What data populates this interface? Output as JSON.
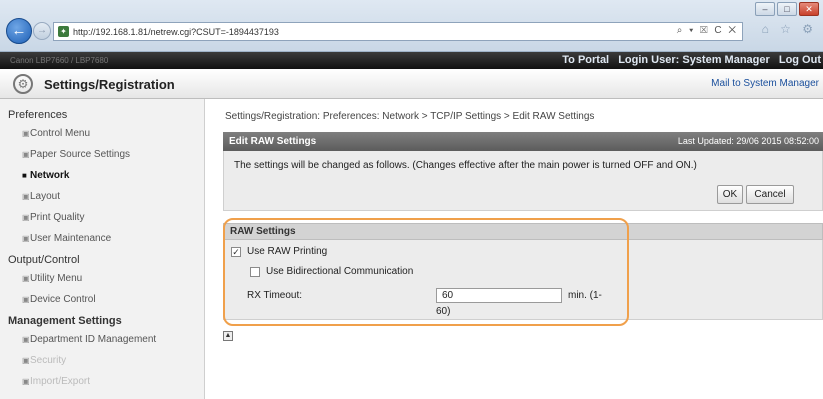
{
  "browser": {
    "url": "http://192.168.1.81/netrew.cgi?CSUT=-1894437193",
    "url_tools": "⌕ ▾ ☒ C ✕",
    "favicon": "✦",
    "icons": "⌂ ☆ ⚙",
    "controls": {
      "minimize": "–",
      "maximize": "□",
      "close": "✕"
    },
    "back_glyph": "←",
    "forward_glyph": "→"
  },
  "topbar": {
    "device_name": "Canon LBP7660 / LBP7680",
    "to_portal": "To Portal",
    "login_user": "Login User: System Manager",
    "logout": "Log Out"
  },
  "header": {
    "title": "Settings/Registration",
    "mail_link": "Mail to System Manager",
    "gear_glyph": "⚙"
  },
  "sidebar": {
    "sections": [
      {
        "heading": "Preferences",
        "items": [
          {
            "label": "Control Menu",
            "active": false
          },
          {
            "label": "Paper Source Settings",
            "active": false
          },
          {
            "label": "Network",
            "active": true
          },
          {
            "label": "Layout",
            "active": false
          },
          {
            "label": "Print Quality",
            "active": false
          },
          {
            "label": "User Maintenance",
            "active": false
          }
        ]
      },
      {
        "heading": "Output/Control",
        "items": [
          {
            "label": "Utility Menu",
            "active": false
          },
          {
            "label": "Device Control",
            "active": false
          }
        ]
      },
      {
        "heading": "Management Settings",
        "items": [
          {
            "label": "Department ID Management",
            "active": false
          },
          {
            "label": "Security",
            "active": false
          },
          {
            "label": "Import/Export",
            "active": false
          }
        ]
      }
    ]
  },
  "main": {
    "breadcrumb": "Settings/Registration: Preferences: Network > TCP/IP Settings > Edit RAW Settings",
    "panel_title": "Edit RAW Settings",
    "last_updated": "Last Updated: 29/06 2015 08:52:00",
    "message": "The settings will be changed as follows. (Changes effective after the main power is turned OFF and ON.)",
    "ok_label": "OK",
    "cancel_label": "Cancel",
    "raw_section_title": "RAW Settings",
    "use_raw_printing": {
      "label": "Use RAW Printing",
      "checked": true
    },
    "use_bidirectional": {
      "label": "Use Bidirectional Communication",
      "checked": false
    },
    "rx_timeout": {
      "label": "RX Timeout:",
      "value": "60",
      "units_line1": "min. (1-",
      "units_line2": "60)"
    },
    "check_glyph": "✓",
    "top_icon_glyph": "▲",
    "highlight_color": "#f0a04b"
  }
}
